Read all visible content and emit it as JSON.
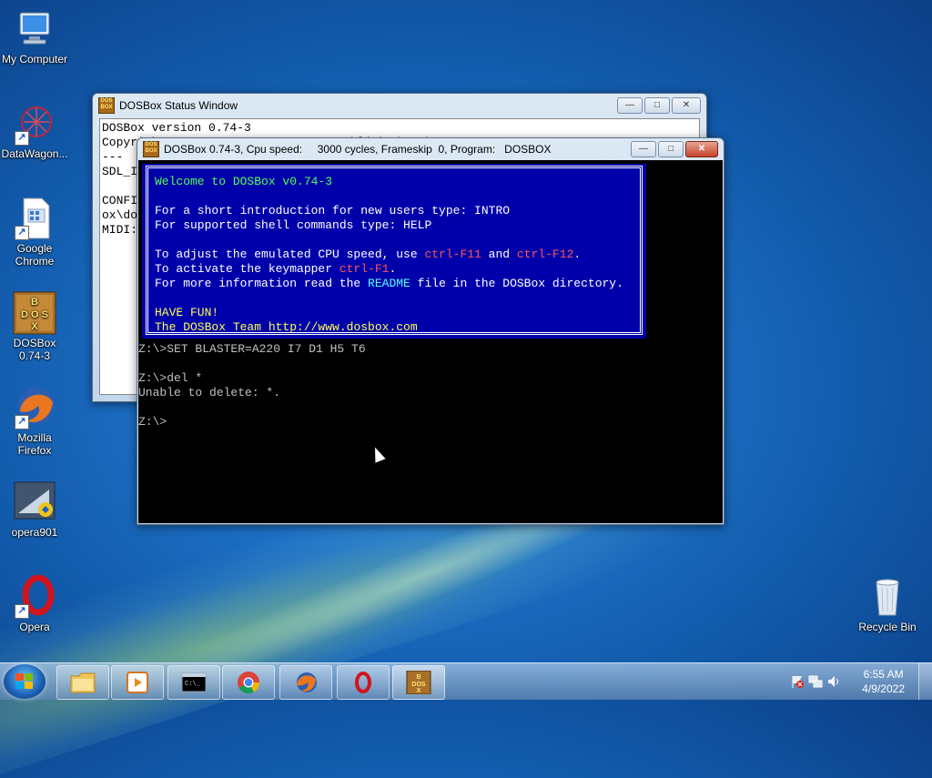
{
  "desktop": {
    "icons": [
      {
        "label": "My Computer"
      },
      {
        "label": "DataWagon..."
      },
      {
        "label": "Google Chrome"
      },
      {
        "label": "DOSBox 0.74-3"
      },
      {
        "label": "Mozilla Firefox"
      },
      {
        "label": "opera901"
      },
      {
        "label": "Opera"
      },
      {
        "label": "Recycle Bin"
      }
    ]
  },
  "status_window": {
    "title": "DOSBox Status Window",
    "lines": "DOSBox version 0.74-3\nCopyright 2002-2019 DOSBox Team, published under GNU GPL.\n---\nSDL_I\n\nCONFI\nox\\do\nMIDI:"
  },
  "dosbox_window": {
    "title": "DOSBox 0.74-3, Cpu speed:     3000 cycles, Frameskip  0, Program:   DOSBOX",
    "banner": {
      "welcome": "Welcome to DOSBox v0.74-3",
      "intro_line": "For a short introduction for new users type: INTRO",
      "help_line": "For supported shell commands type: HELP",
      "cpu_prefix": "To adjust the emulated CPU speed, use ",
      "cpu_key1": "ctrl-F11",
      "cpu_and": " and ",
      "cpu_key2": "ctrl-F12",
      "cpu_suffix": ".",
      "keymap_prefix": "To activate the keymapper ",
      "keymap_key": "ctrl-F1",
      "keymap_suffix": ".",
      "readme_prefix": "For more information read the ",
      "readme_key": "README",
      "readme_suffix": " file in the DOSBox directory.",
      "have_fun": "HAVE FUN!",
      "team_prefix": "The DOSBox Team ",
      "team_url": "http://www.dosbox.com"
    },
    "console": "Z:\\>SET BLASTER=A220 I7 D1 H5 T6\n\nZ:\\>del *\nUnable to delete: *.\n\nZ:\\>"
  },
  "taskbar": {
    "clock_time": "6:55 AM",
    "clock_date": "4/9/2022"
  }
}
